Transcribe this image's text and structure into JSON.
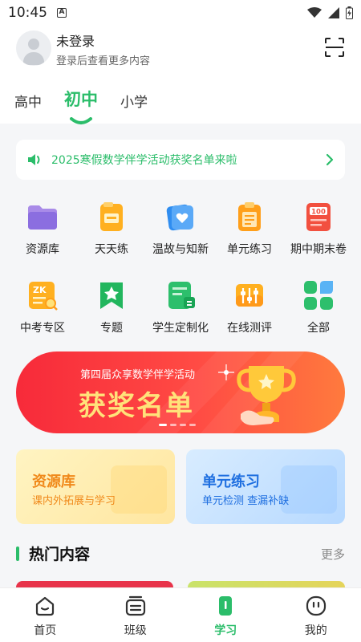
{
  "status_bar": {
    "time": "10:45",
    "icons": [
      "a-icon",
      "wifi-icon",
      "signal-icon",
      "battery-icon"
    ]
  },
  "user": {
    "name": "未登录",
    "subtitle": "登录后查看更多内容",
    "scan_icon": "scan-icon"
  },
  "grade_tabs": [
    {
      "label": "高中",
      "active": false
    },
    {
      "label": "初中",
      "active": true
    },
    {
      "label": "小学",
      "active": false
    }
  ],
  "notice": {
    "text": "2025寒假数学伴学活动获奖名单来啦",
    "icon": "speaker-icon"
  },
  "features": [
    {
      "label": "资源库",
      "icon": "folder-icon"
    },
    {
      "label": "天天练",
      "icon": "daily-practice-icon"
    },
    {
      "label": "温故与知新",
      "icon": "heart-card-icon"
    },
    {
      "label": "单元练习",
      "icon": "clipboard-icon"
    },
    {
      "label": "期中期末卷",
      "icon": "score-100-icon"
    },
    {
      "label": "中考专区",
      "icon": "zk-icon"
    },
    {
      "label": "专题",
      "icon": "star-ribbon-icon"
    },
    {
      "label": "学生定制化",
      "icon": "custom-card-icon"
    },
    {
      "label": "在线测评",
      "icon": "sliders-icon"
    },
    {
      "label": "全部",
      "icon": "grid-icon"
    }
  ],
  "banner": {
    "subtitle": "第四届众享数学伴学活动",
    "title": "获奖名单",
    "slides": 4,
    "active_slide": 1
  },
  "cards": [
    {
      "title": "资源库",
      "desc": "课内外拓展与学习"
    },
    {
      "title": "单元练习",
      "desc": "单元检测  查漏补缺"
    }
  ],
  "section": {
    "title": "热门内容",
    "more": "更多"
  },
  "tabbar": [
    {
      "label": "首页",
      "icon": "home-icon",
      "active": false
    },
    {
      "label": "班级",
      "icon": "class-icon",
      "active": false
    },
    {
      "label": "学习",
      "icon": "study-icon",
      "active": true
    },
    {
      "label": "我的",
      "icon": "profile-icon",
      "active": false
    }
  ],
  "colors": {
    "accent": "#2bbd6a",
    "banner_red": "#f72a3a",
    "banner_text": "#ffe27a",
    "card_yellow_text": "#f0891a",
    "card_blue_text": "#1f6fe0"
  }
}
